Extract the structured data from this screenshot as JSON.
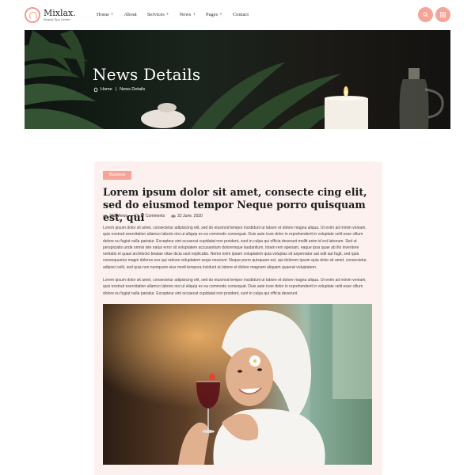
{
  "brand": {
    "name": "Mixlax.",
    "tagline": "Beauty Spa Center"
  },
  "nav": [
    {
      "label": "Home",
      "has_children": true
    },
    {
      "label": "About",
      "has_children": false
    },
    {
      "label": "Services",
      "has_children": true
    },
    {
      "label": "News",
      "has_children": true
    },
    {
      "label": "Pages",
      "has_children": true
    },
    {
      "label": "Contact",
      "has_children": false
    }
  ],
  "nav_plus": "+",
  "icons": {
    "search": "search-icon",
    "menu": "grid-menu-icon"
  },
  "colors": {
    "accent": "#f5a497",
    "card_bg": "#fcf1ef"
  },
  "banner": {
    "title": "News Details",
    "breadcrumb": {
      "home": "Home",
      "separator": "|",
      "current": "News Details"
    }
  },
  "article": {
    "category": "Business",
    "title": "Lorem ipsum dolor sit amet, consecte cing elit, sed do eiusmod tempor Neque porro quisquam est, qui",
    "views": "232 Views",
    "comments": "17 Comments",
    "date": "22 June, 2020",
    "paragraph1": "Lorem ipsum dolor sit amet, consectetur adipisicing elit, sed do eiusmod tempor incididunt ut labore et dolore magna aliqua. Ut enim ad minim veniam, quis nostrud exercitation ullamco laboris nisi ut aliquip ex ea commodo consequat. Duis aute irure dolor in reprehenderit in voluptate velit esse cillum dolore eu fugiat nulla pariatur. Excepteur sint occaecat cupidatat non proident, sunt in culpa qui officia deserunt mollit anim id est laborum. Sed ut perspiciatis unde omnis iste natus error sit voluptatem accusantium doloremque laudantium, totam rem aperiam, eaque ipsa quae ab illo inventore veritatis et quasi architecto beatae vitae dicta sunt explicabo. Nemo enim ipsam voluptatem quia voluptas sit aspernatur aut odit aut fugit, sed quia consequuntur magni dolores eos qui ratione voluptatem sequi nesciunt. Neque porro quisquam est, qui dolorem ipsum quia dolor sit amet, consectetur, adipisci velit, sed quia non numquam eius modi tempora incidunt ut labore et dolore magnam aliquam quaerat voluptatem.",
    "paragraph2": "Lorem ipsum dolor sit amet, consectetur adipisicing elit, sed do eiusmod tempor incididunt ut labore et dolore magna aliqua. Ut enim ad minim veniam, quis nostrud exercitation ullamco laboris nisi ut aliquip ex ea commodo consequat. Duis aute irure dolor in reprehenderit in voluptate velit esse cillum dolore eu fugiat nulla pariatur. Excepteur sint occaecat cupidatat non proident, sunt in culpa qui officia deserunt."
  }
}
